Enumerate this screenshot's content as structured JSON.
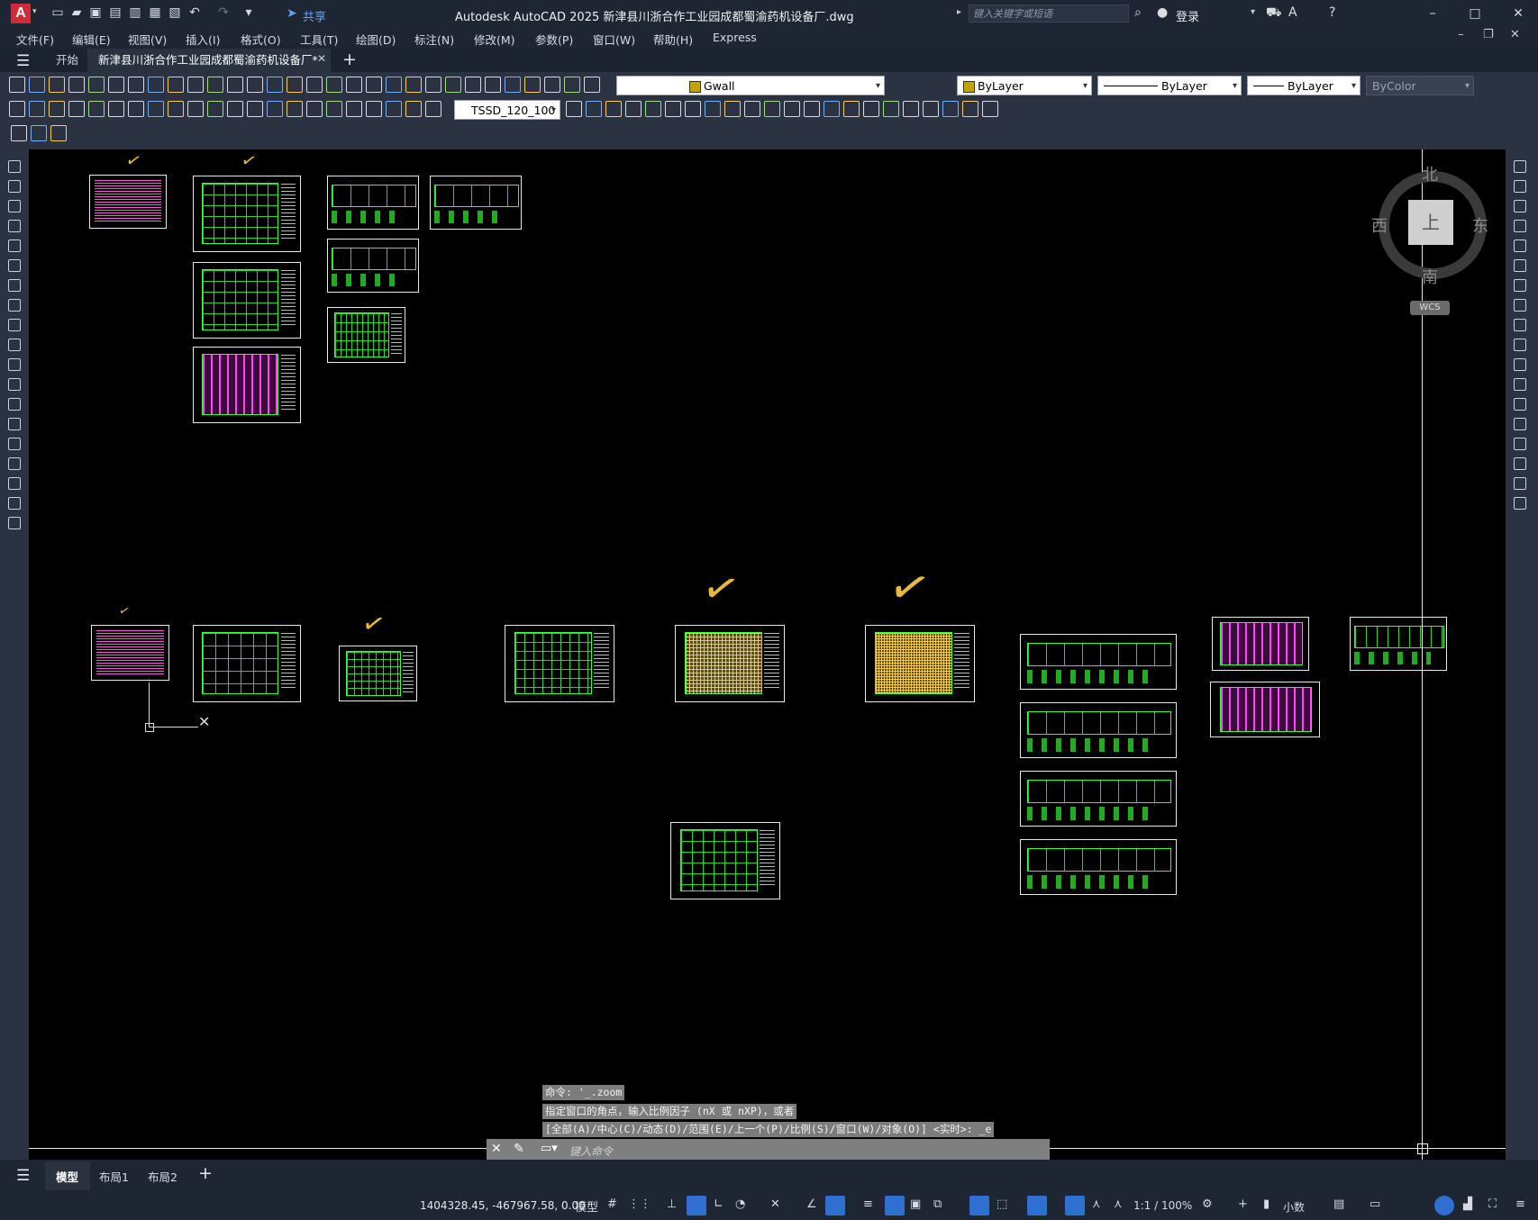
{
  "app": {
    "logo": "A",
    "title": "Autodesk AutoCAD 2025   新津县川浙合作工业园成都蜀渝药机设备厂.dwg",
    "share_label": "共享",
    "search_placeholder": "键入关键字或短语",
    "login_label": "登录"
  },
  "menu": [
    "文件(F)",
    "编辑(E)",
    "视图(V)",
    "插入(I)",
    "格式(O)",
    "工具(T)",
    "绘图(D)",
    "标注(N)",
    "修改(M)",
    "参数(P)",
    "窗口(W)",
    "帮助(H)",
    "Express"
  ],
  "tabs": {
    "start": "开始",
    "active": "新津县川浙合作工业园成都蜀渝药机设备厂*"
  },
  "toolbar": {
    "layer": "Gwall",
    "color": "ByLayer",
    "linetype": "ByLayer",
    "lineweight": "ByLayer",
    "plotstyle": "ByColor",
    "dimstyle": "TSSD_120_100"
  },
  "viewcube": {
    "north": "北",
    "south": "南",
    "east": "东",
    "west": "西",
    "face": "上",
    "wcs": "WCS"
  },
  "command": {
    "history": [
      "命令: '_.zoom",
      "指定窗口的角点，输入比例因子 (nX 或 nXP)，或者",
      "[全部(A)/中心(C)/动态(D)/范围(E)/上一个(P)/比例(S)/窗口(W)/对象(O)] <实时>: _e"
    ],
    "placeholder": "键入命令"
  },
  "layout_tabs": [
    "模型",
    "布局1",
    "布局2"
  ],
  "status": {
    "coordinates": "1404328.45, -467967.58, 0.00",
    "model_label": "模型",
    "scale": "1:1 / 100%",
    "units": "小数"
  },
  "colors": {
    "canvas": "#000000",
    "drawing_lines": "#39ff39",
    "text_blocks": "#ff55dd",
    "checkmarks": "#e9b93a",
    "chrome": "#2b3342"
  }
}
